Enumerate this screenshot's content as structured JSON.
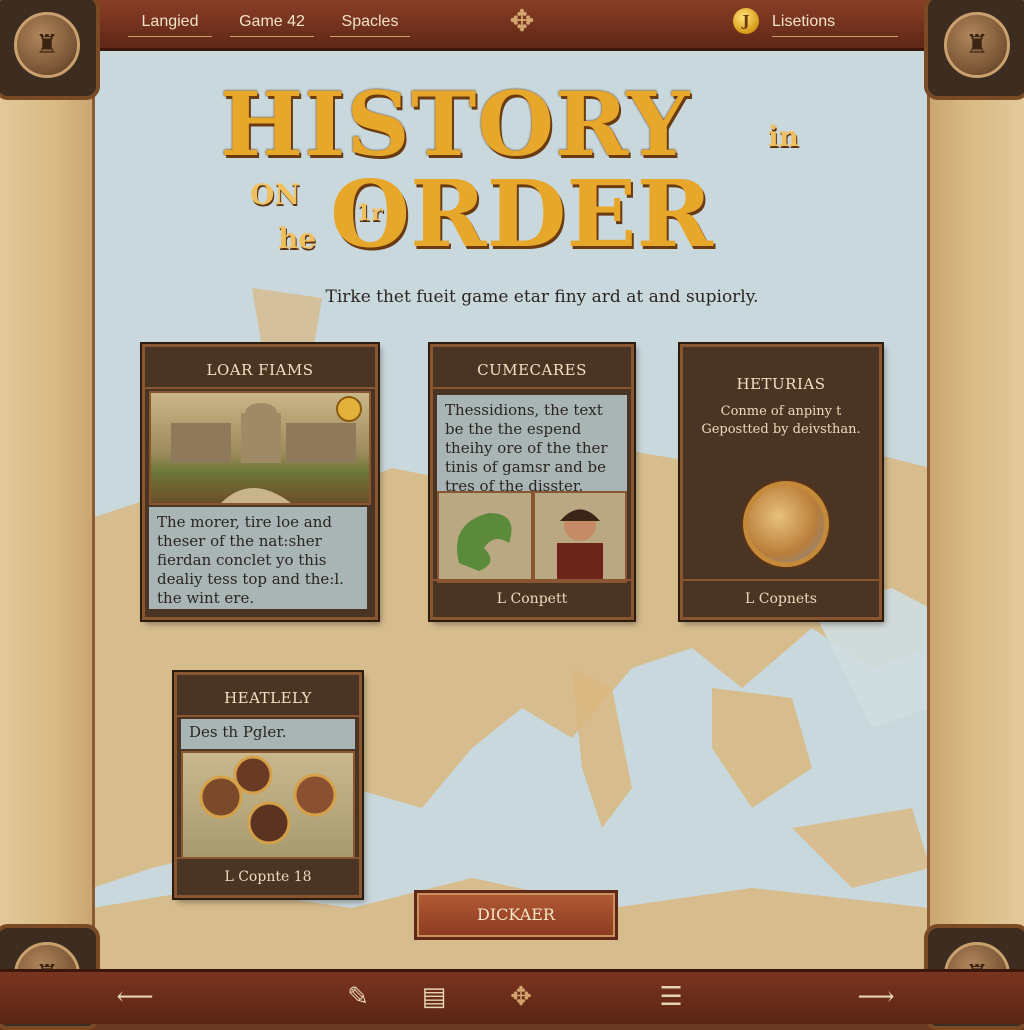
{
  "topbar": {
    "tabs": [
      "Langied",
      "Game 42",
      "Spacles"
    ],
    "settings_label": "Lisetions",
    "coin_glyph": "J",
    "emblem_glyph": "✥"
  },
  "corner_glyph": "♜",
  "title": {
    "line1": "HISTORY",
    "small_in": "in",
    "small_on": "ON",
    "small_the": "he",
    "line2": "ORDER",
    "badge": "1r"
  },
  "subtitle": "Tirke thet fueit game etar finy ard at and supiorly.",
  "cards": [
    {
      "title": "LOAR FIAMS",
      "text": "The morer, tire loe and theser of the nat:sher fierdan conclet yo this dealiy tess top and the:l. the wint ere.",
      "footer": ""
    },
    {
      "title": "CUMECARES",
      "text": "Thessidions, the text be the the espend theihy ore of the ther tinis of gamsr and be tres of the disster.",
      "footer": "L Conpett"
    },
    {
      "title": "HETURIAS",
      "text": "Conme of anpiny t Gepostted by deivsthan.",
      "footer": "L Copnets"
    },
    {
      "title": "HEATLELY",
      "text": "Des th Pgler.",
      "footer": "L Copnte 18"
    }
  ],
  "decide_button": "DICKAER",
  "bottombar": {
    "back_icon": "⟵",
    "forward_icon": "⟶",
    "feather_icon": "✎",
    "book_icon": "▤",
    "emblem_icon": "✥",
    "list_icon": "☰"
  },
  "colors": {
    "gold": "#e7a72b",
    "wood": "#5e2716",
    "card": "#4a3525",
    "sea": "#c9d8dd",
    "land": "#d9b77f"
  }
}
